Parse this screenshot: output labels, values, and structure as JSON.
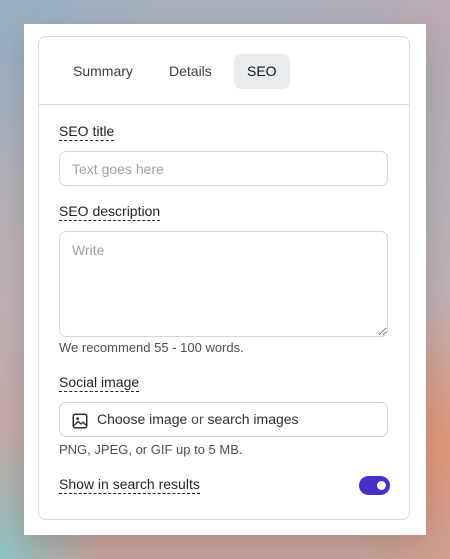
{
  "tabs": [
    {
      "label": "Summary",
      "active": false
    },
    {
      "label": "Details",
      "active": false
    },
    {
      "label": "SEO",
      "active": true
    }
  ],
  "seo_title": {
    "label": "SEO title",
    "placeholder": "Text goes here",
    "value": ""
  },
  "seo_description": {
    "label": "SEO description",
    "placeholder": "Write",
    "value": "",
    "hint": "We recommend 55 - 100 words."
  },
  "social_image": {
    "label": "Social image",
    "choose_text": "Choose image",
    "or_text": "or",
    "search_text": "search images",
    "hint": "PNG, JPEG, or GIF up to 5 MB.",
    "icon": "image-icon"
  },
  "search_visibility": {
    "label": "Show in search results",
    "enabled": true
  },
  "colors": {
    "accent": "#4a2ec8",
    "active_tab_bg": "#e9ecee",
    "border": "#d0d5db"
  }
}
